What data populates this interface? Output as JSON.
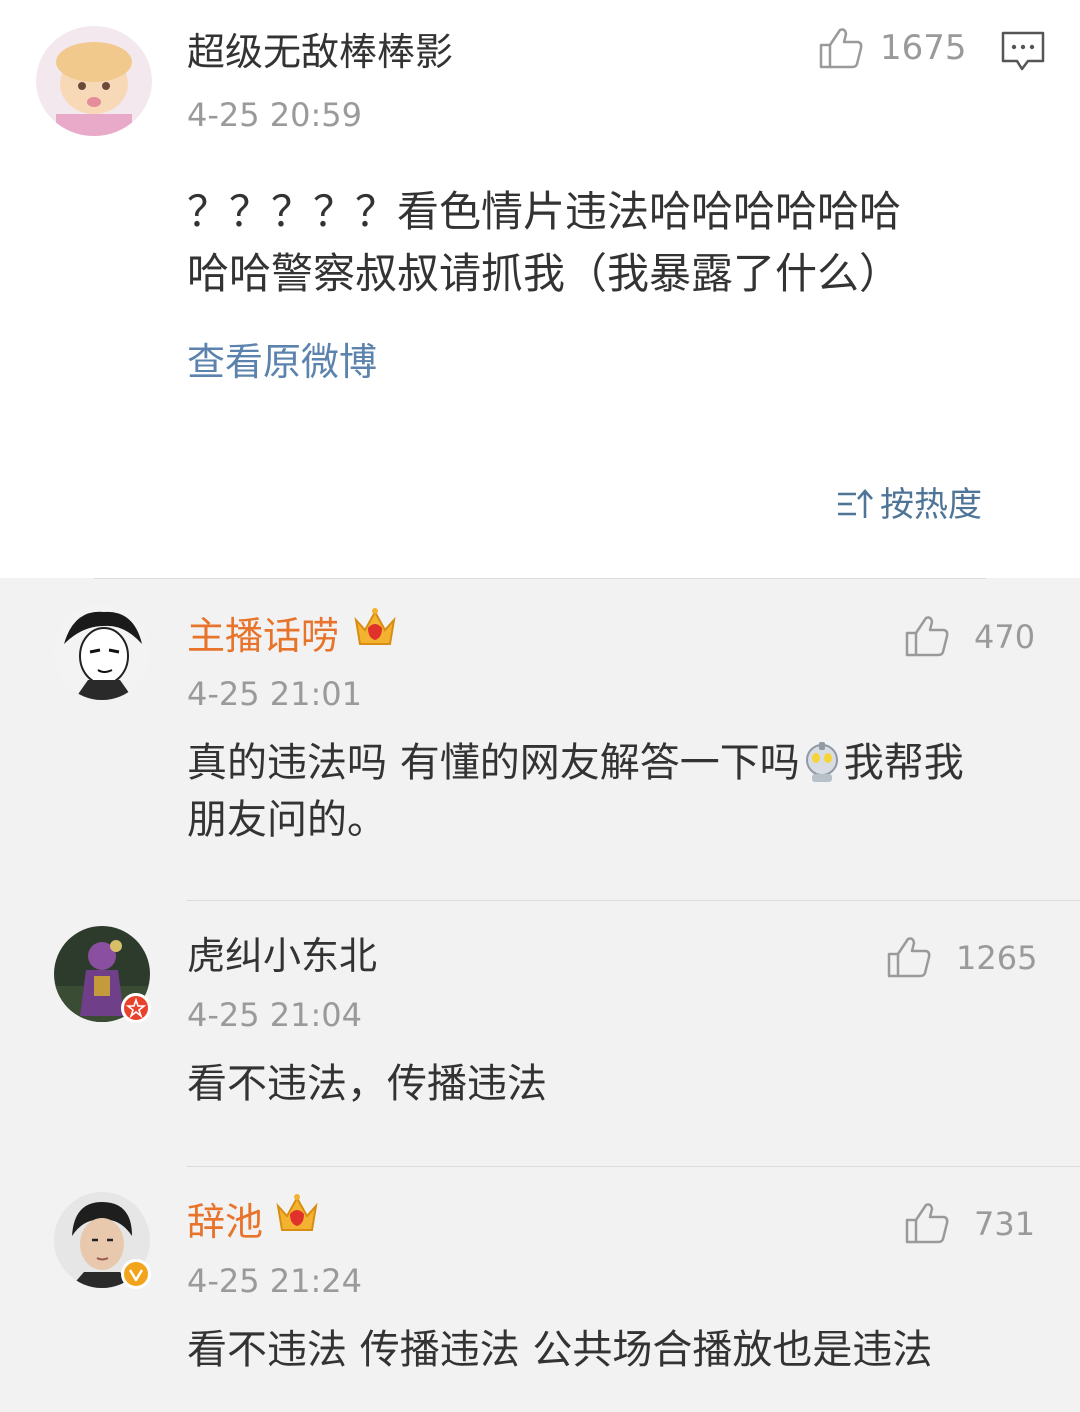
{
  "post": {
    "author": "超级无敌棒棒影",
    "time": "4-25 20:59",
    "likes": "1675",
    "text_line1": "？？？？？看色情片违法哈哈哈哈哈哈",
    "text_line2": "哈哈警察叔叔请抓我（我暴露了什么）",
    "view_original": "查看原微博",
    "sort_label": "按热度"
  },
  "comments": [
    {
      "author": "主播话唠",
      "time": "4-25 21:01",
      "likes": "470",
      "text_line1_a": "真的违法吗 有懂的网友解答一下吗",
      "text_line1_b": "我帮我",
      "text_line2": "朋友问的。"
    },
    {
      "author": "虎纠小东北",
      "time": "4-25 21:04",
      "likes": "1265",
      "text_line1": "看不违法，传播违法"
    },
    {
      "author": "辞池",
      "time": "4-25 21:24",
      "likes": "731",
      "text_line1": "看不违法 传播违法 公共场合播放也是违法"
    }
  ],
  "colors": {
    "vip_name": "#e8732b",
    "link": "#5b83ad",
    "meta": "#9a9a9a",
    "background": "#f2f2f2"
  },
  "icons": [
    "thumb-up-icon",
    "comment-icon",
    "sort-icon",
    "crown-icon",
    "emoji-icon",
    "verified-badge-icon"
  ]
}
